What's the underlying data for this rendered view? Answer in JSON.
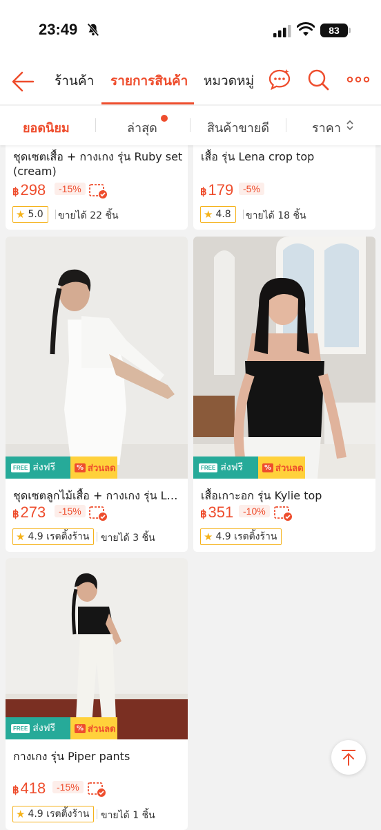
{
  "status": {
    "time": "23:49",
    "battery": "83"
  },
  "nav": {
    "tabs": [
      {
        "label": "ร้านค้า"
      },
      {
        "label": "รายการสินค้า"
      },
      {
        "label": "หมวดหมู่"
      }
    ]
  },
  "filters": [
    {
      "label": "ยอดนิยม"
    },
    {
      "label": "ล่าสุด"
    },
    {
      "label": "สินค้าขายดี"
    },
    {
      "label": "ราคา"
    }
  ],
  "products": [
    {
      "title": "ชุดเซตเสื้อ + กางเกง รุ่น Ruby set",
      "title2": "(cream)",
      "currency": "฿",
      "price": "298",
      "discount": "-15%",
      "rating": "5.0",
      "sold": "ขายได้ 22 ชิ้น"
    },
    {
      "title": "เสื้อ รุ่น Lena crop top",
      "currency": "฿",
      "price": "179",
      "discount": "-5%",
      "rating": "4.8",
      "sold": "ขายได้ 18 ชิ้น"
    },
    {
      "title": "ชุดเซตลูกไม้เสื้อ + กางเกง รุ่น La...",
      "currency": "฿",
      "price": "273",
      "discount": "-15%",
      "rating": "4.9 เรตติ้งร้าน",
      "sold": "ขายได้ 3 ชิ้น"
    },
    {
      "title": "เสื้อเกาะอก รุ่น Kylie top",
      "currency": "฿",
      "price": "351",
      "discount": "-10%",
      "rating": "4.9 เรตติ้งร้าน"
    },
    {
      "title": "กางเกง รุ่น Piper pants",
      "currency": "฿",
      "price": "418",
      "discount": "-15%",
      "rating": "4.9 เรตติ้งร้าน",
      "sold": "ขายได้ 1 ชิ้น"
    }
  ],
  "promo": {
    "free_ship": "ส่งฟรี",
    "free_badge": "FREE",
    "sale": "ส่วนลด",
    "sale_badge": "%"
  },
  "colors": {
    "accent": "#ee4d2d",
    "free_ship": "#26aa99",
    "sale": "#ffd13b"
  }
}
